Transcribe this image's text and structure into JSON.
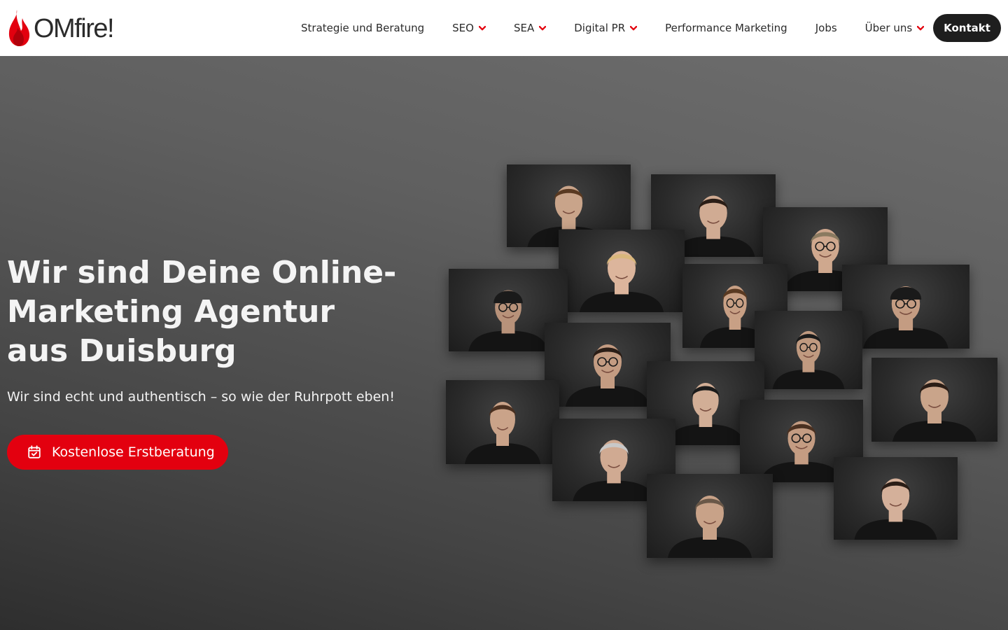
{
  "brand": {
    "name": "OMfire!",
    "accent_color": "#e3000f",
    "logo_icon": "flame-icon"
  },
  "nav": {
    "items": [
      {
        "label": "Strategie und Beratung",
        "has_dropdown": false
      },
      {
        "label": "SEO",
        "has_dropdown": true
      },
      {
        "label": "SEA",
        "has_dropdown": true
      },
      {
        "label": "Digital PR",
        "has_dropdown": true
      },
      {
        "label": "Performance Marketing",
        "has_dropdown": false
      },
      {
        "label": "Jobs",
        "has_dropdown": false
      },
      {
        "label": "Über uns",
        "has_dropdown": true
      }
    ],
    "contact_label": "Kontakt"
  },
  "hero": {
    "title": "Wir sind Deine Online-Marketing Agentur aus Duisburg",
    "subtitle": "Wir sind echt und authentisch – so wie der Ruhrpott eben!",
    "cta_label": "Kostenlose Erstberatung",
    "cta_icon": "calendar-check-icon"
  },
  "team_photos": [
    {
      "hair": "#5a3a22",
      "skin": "#c9a48a",
      "glasses": false,
      "beanie": false
    },
    {
      "hair": "#2a1d16",
      "skin": "#d0ab93",
      "glasses": false,
      "beanie": false
    },
    {
      "hair": "#1a1a1a",
      "skin": "#c49c82",
      "glasses": true,
      "beanie": true
    },
    {
      "hair": "#8a7a60",
      "skin": "#cfa88e",
      "glasses": true,
      "beanie": false
    },
    {
      "hair": "#1a1a1a",
      "skin": "#b8927a",
      "glasses": true,
      "beanie": true
    },
    {
      "hair": "#5a3a22",
      "skin": "#c8a085",
      "glasses": true,
      "beanie": false
    },
    {
      "hair": "#d9b77c",
      "skin": "#dcb59c",
      "glasses": false,
      "beanie": false
    },
    {
      "hair": "#2a1d16",
      "skin": "#c49c82",
      "glasses": true,
      "beanie": false
    },
    {
      "hair": "#1a1a1a",
      "skin": "#c09a80",
      "glasses": true,
      "beanie": false
    },
    {
      "hair": "#4a3020",
      "skin": "#caa389",
      "glasses": false,
      "beanie": false
    },
    {
      "hair": "#2a1d16",
      "skin": "#c9a48a",
      "glasses": false,
      "beanie": false
    },
    {
      "hair": "#1a1a1a",
      "skin": "#d2ae96",
      "glasses": false,
      "beanie": false
    },
    {
      "hair": "#4a3020",
      "skin": "#c49c82",
      "glasses": true,
      "beanie": false
    },
    {
      "hair": "#c8c8c8",
      "skin": "#d0aa92",
      "glasses": false,
      "beanie": false
    },
    {
      "hair": "#2a1d16",
      "skin": "#d4b09a",
      "glasses": false,
      "beanie": false
    },
    {
      "hair": "#6a5848",
      "skin": "#c8a288",
      "glasses": false,
      "beanie": false
    }
  ]
}
